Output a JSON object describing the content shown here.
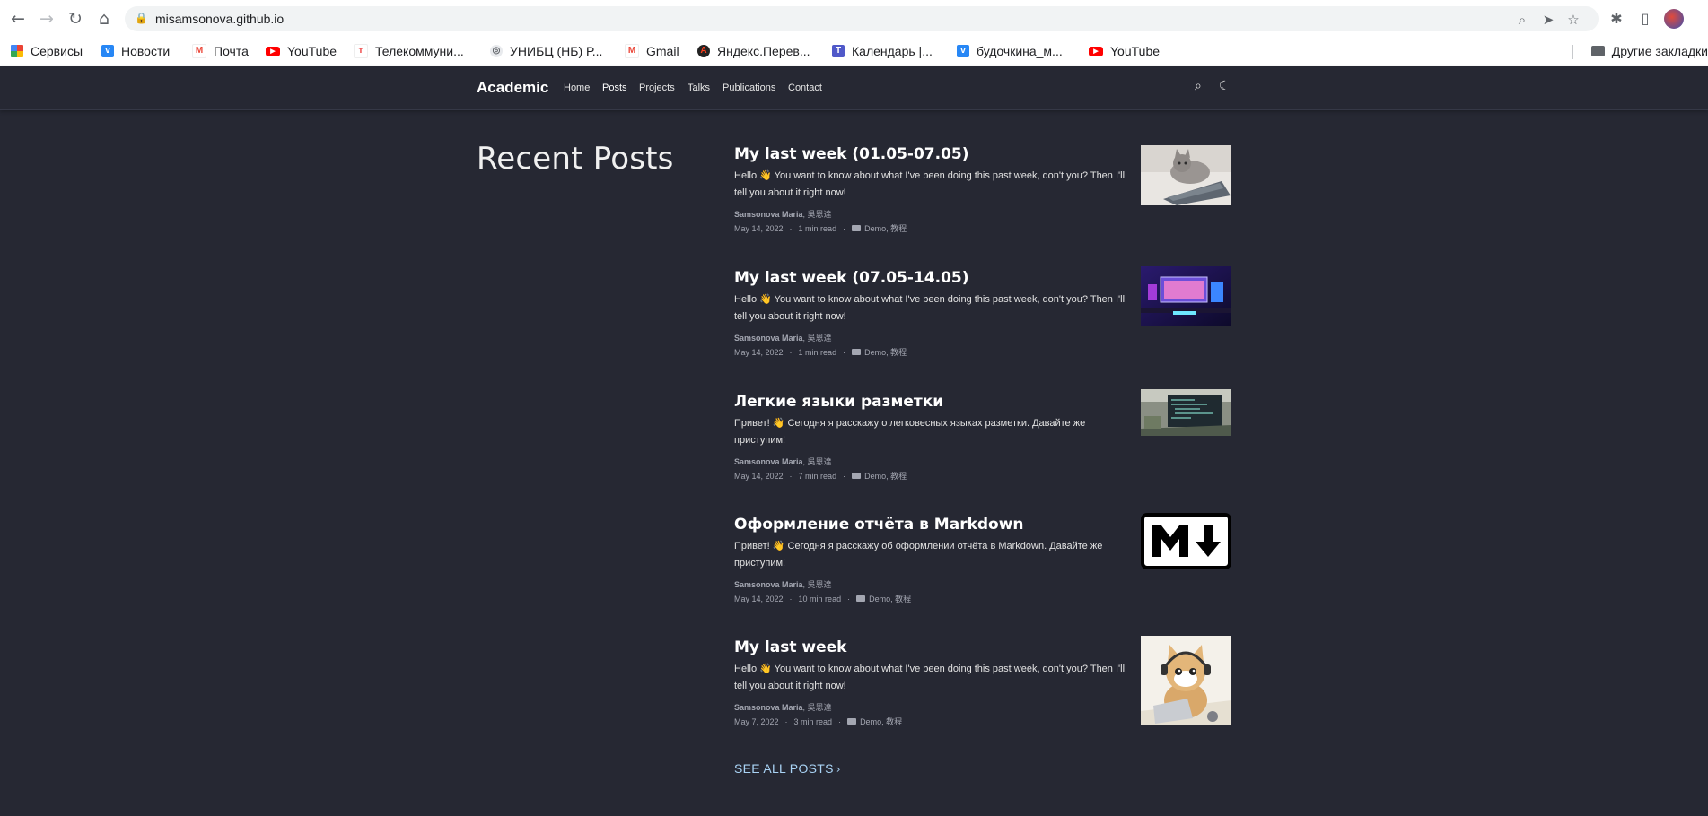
{
  "browser": {
    "url": "misamsonova.github.io",
    "bookmarks": [
      {
        "label": "Сервисы",
        "icon": "apps-grid-icon"
      },
      {
        "label": "Новости",
        "icon": "vk-icon"
      },
      {
        "label": "Почта",
        "icon": "gmail-icon"
      },
      {
        "label": "YouTube",
        "icon": "youtube-icon"
      },
      {
        "label": "Телекоммуни...",
        "icon": "telecom-icon"
      },
      {
        "label": "УНИБЦ (НБ) Р...",
        "icon": "globe-icon"
      },
      {
        "label": "Gmail",
        "icon": "gmail-icon"
      },
      {
        "label": "Яндекс.Перев...",
        "icon": "yandex-translate-icon"
      },
      {
        "label": "Календарь |...",
        "icon": "teams-icon"
      },
      {
        "label": "будочкина_м...",
        "icon": "vk-icon"
      },
      {
        "label": "YouTube",
        "icon": "youtube-icon"
      }
    ],
    "other_bookmarks": "Другие закладки"
  },
  "site": {
    "brand": "Academic",
    "nav": [
      {
        "label": "Home",
        "active": false
      },
      {
        "label": "Posts",
        "active": true
      },
      {
        "label": "Projects",
        "active": false
      },
      {
        "label": "Talks",
        "active": false
      },
      {
        "label": "Publications",
        "active": false
      },
      {
        "label": "Contact",
        "active": false
      }
    ]
  },
  "main": {
    "title": "Recent Posts",
    "posts": [
      {
        "title": "My last week (01.05-07.05)",
        "summary": "Hello 👋 You want to know about what I've been doing this past week, don't you? Then I'll tell you about it right now!",
        "author": "Samsonova Maria",
        "coauthor": "吳恩達",
        "date": "May 14, 2022",
        "read": "1 min read",
        "categories": "Demo, 教程",
        "thumb": "cat-on-laptop"
      },
      {
        "title": "My last week (07.05-14.05)",
        "summary": "Hello 👋 You want to know about what I've been doing this past week, don't you? Then I'll tell you about it right now!",
        "author": "Samsonova Maria",
        "coauthor": "吳恩達",
        "date": "May 14, 2022",
        "read": "1 min read",
        "categories": "Demo, 教程",
        "thumb": "gaming-setup"
      },
      {
        "title": "Легкие языки разметки",
        "summary": "Привет! 👋 Сегодня я расскажу о легковесных языках разметки. Давайте же приступим!",
        "author": "Samsonova Maria",
        "coauthor": "吳恩達",
        "date": "May 14, 2022",
        "read": "7 min read",
        "categories": "Demo, 教程",
        "thumb": "laptop-code"
      },
      {
        "title": "Оформление отчёта в Markdown",
        "summary": "Привет! 👋 Сегодня я расскажу об оформлении отчёта в Markdown. Давайте же приступим!",
        "author": "Samsonova Maria",
        "coauthor": "吳恩達",
        "date": "May 14, 2022",
        "read": "10 min read",
        "categories": "Demo, 教程",
        "thumb": "markdown-logo"
      },
      {
        "title": "My last week",
        "summary": "Hello 👋 You want to know about what I've been doing this past week, don't you? Then I'll tell you about it right now!",
        "author": "Samsonova Maria",
        "coauthor": "吳恩達",
        "date": "May 7, 2022",
        "read": "3 min read",
        "categories": "Demo, 教程",
        "thumb": "cartoon-cat-headset"
      }
    ],
    "see_all": "SEE ALL POSTS"
  }
}
